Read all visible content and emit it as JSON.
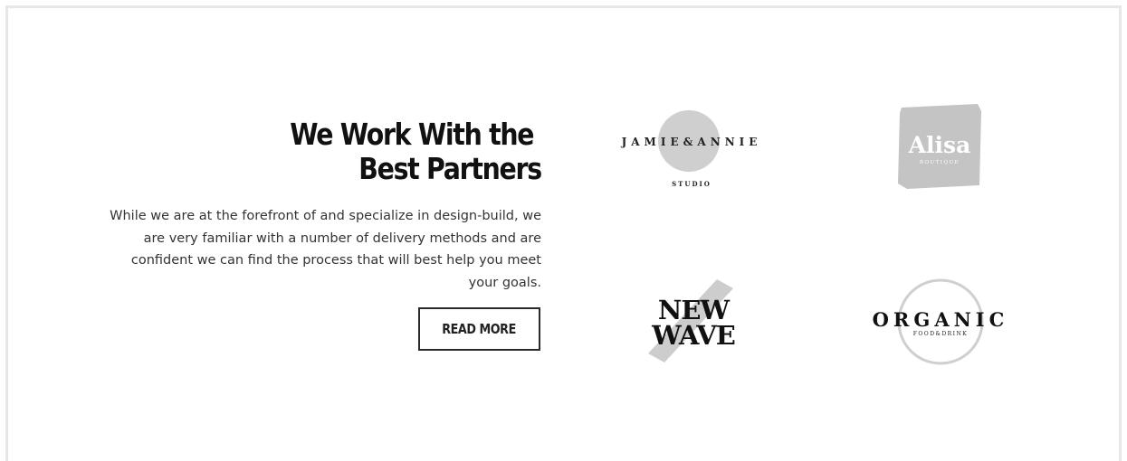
{
  "section": {
    "heading_line1": "We Work With the",
    "heading_line2": "Best Partners",
    "description": "While we are at the forefront of and specialize in design-build, we are very familiar with a number of delivery methods and are confident we can find the process that will best help you meet your goals.",
    "button_label": "READ MORE"
  },
  "partners": {
    "jamie": {
      "name": "JAMIE&ANNIE",
      "sub": "STUDIO"
    },
    "alisa": {
      "name": "Alisa",
      "sub": "BOUTIQUE"
    },
    "newwave": {
      "line1": "NEW",
      "line2": "WAVE"
    },
    "organic": {
      "name": "ORGANIC",
      "sub": "FOOD&DRINK"
    }
  },
  "colors": {
    "text": "#111111",
    "body_text": "#333333",
    "logo_gray": "#c8c8c8",
    "border": "#e7e7e7"
  }
}
